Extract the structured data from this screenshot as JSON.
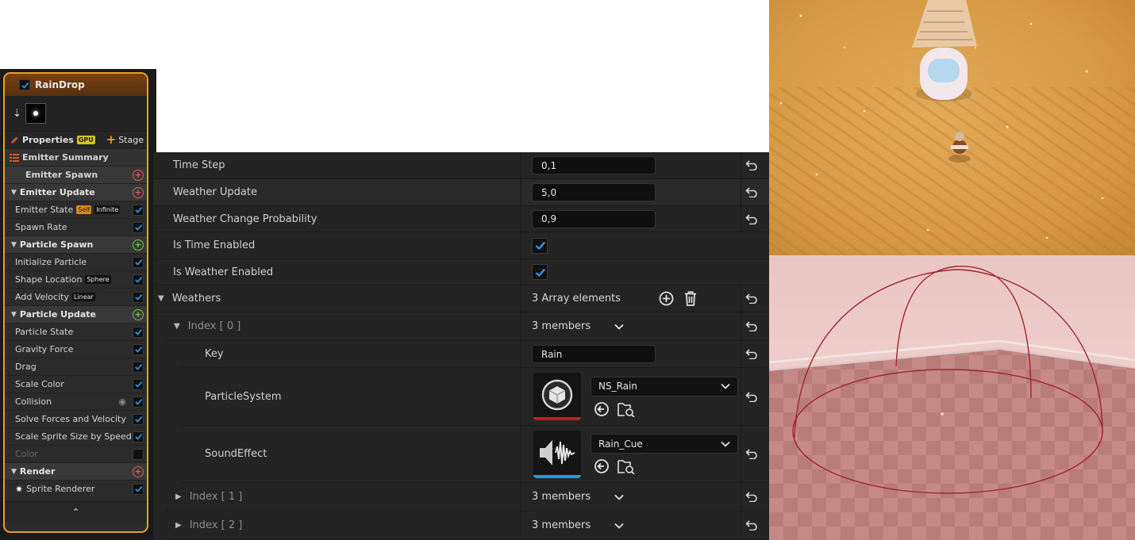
{
  "emitter": {
    "name": "RainDrop",
    "enabled": true,
    "properties_label": "Properties",
    "gpu_badge": "GPU",
    "stage_label": "Stage",
    "summary_label": "Emitter Summary",
    "spawn_label": "Emitter Spawn",
    "sections": [
      {
        "label": "Emitter Update",
        "add_color": "red",
        "items": [
          {
            "label": "Emitter State",
            "tags": [
              "Self",
              "Infinite"
            ],
            "checked": true
          },
          {
            "label": "Spawn Rate",
            "tags": [],
            "checked": true
          }
        ]
      },
      {
        "label": "Particle Spawn",
        "add_color": "green",
        "items": [
          {
            "label": "Initialize Particle",
            "tags": [],
            "checked": true
          },
          {
            "label": "Shape Location",
            "tags": [
              "Sphere"
            ],
            "checked": true
          },
          {
            "label": "Add Velocity",
            "tags": [
              "Linear"
            ],
            "checked": true
          }
        ]
      },
      {
        "label": "Particle Update",
        "add_color": "green",
        "items": [
          {
            "label": "Particle State",
            "tags": [],
            "checked": true
          },
          {
            "label": "Gravity Force",
            "tags": [],
            "checked": true
          },
          {
            "label": "Drag",
            "tags": [],
            "checked": true
          },
          {
            "label": "Scale Color",
            "tags": [],
            "checked": true
          },
          {
            "label": "Collision",
            "tags": [],
            "checked": true,
            "eye": true
          },
          {
            "label": "Solve Forces and Velocity",
            "tags": [],
            "checked": true
          },
          {
            "label": "Scale Sprite Size by Speed",
            "tags": [],
            "checked": true
          },
          {
            "label": "Color",
            "tags": [],
            "checked": false,
            "dim": true
          }
        ]
      },
      {
        "label": "Render",
        "add_color": "red",
        "items": [
          {
            "label": "Sprite Renderer",
            "tags": [],
            "checked": true,
            "sprite": true
          }
        ]
      }
    ],
    "collapse_glyph": "⌃"
  },
  "details": {
    "time_step": {
      "label": "Time Step",
      "value": "0,1"
    },
    "weather_update": {
      "label": "Weather Update",
      "value": "5,0"
    },
    "weather_change": {
      "label": "Weather Change Probability",
      "value": "0,9"
    },
    "is_time_enabled": {
      "label": "Is Time Enabled",
      "checked": true
    },
    "is_weather_enabled": {
      "label": "Is Weather Enabled",
      "checked": true
    },
    "weathers": {
      "label": "Weathers",
      "value": "3 Array elements"
    },
    "index0": {
      "label": "Index [ 0 ]",
      "value": "3 members"
    },
    "key": {
      "label": "Key",
      "value": "Rain"
    },
    "particle_system": {
      "label": "ParticleSystem",
      "asset": "NS_Rain"
    },
    "sound_effect": {
      "label": "SoundEffect",
      "asset": "Rain_Cue"
    },
    "index1": {
      "label": "Index [ 1 ]",
      "value": "3 members"
    },
    "index2": {
      "label": "Index [ 2 ]",
      "value": "3 members"
    }
  },
  "colors": {
    "emitter_border": "#e8a020",
    "checkbox_tick": "#2e8fe6",
    "particle_strip": "#c0201e",
    "sound_strip": "#1e9ee0"
  }
}
